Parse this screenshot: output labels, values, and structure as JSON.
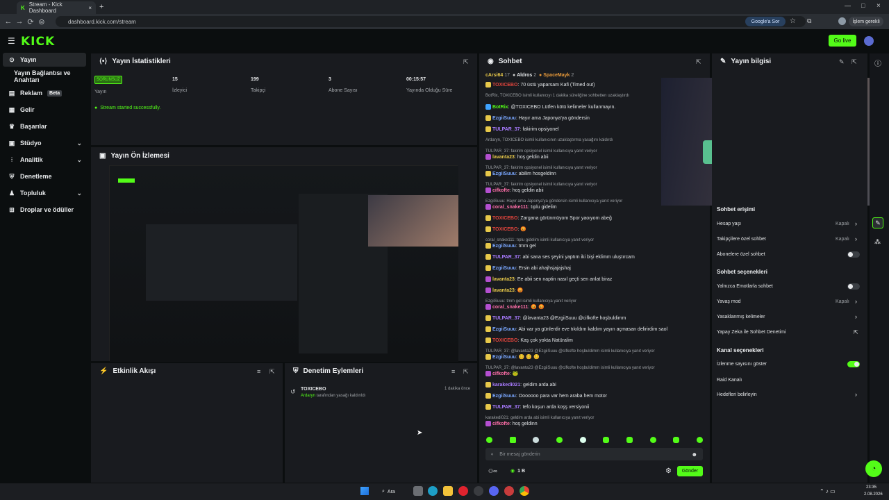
{
  "browser": {
    "tab_title": "Stream - Kick Dashboard",
    "url": "dashboard.kick.com/stream",
    "google_ask": "Google'a Sor",
    "pending": "İşlem gerekli"
  },
  "header": {
    "logo": "KICK",
    "go_live": "Go live"
  },
  "sidebar": {
    "items": [
      {
        "label": "Yayın",
        "icon": "broadcast-icon"
      },
      {
        "label": "Yayın Bağlantısı ve Anahtarı",
        "icon": ""
      },
      {
        "label": "Reklam",
        "icon": "ads-icon",
        "badge": "Beta"
      },
      {
        "label": "Gelir",
        "icon": "revenue-icon"
      },
      {
        "label": "Başarılar",
        "icon": "trophy-icon"
      },
      {
        "label": "Stüdyo",
        "icon": "studio-icon"
      },
      {
        "label": "Analitik",
        "icon": "analytics-icon"
      },
      {
        "label": "Denetleme",
        "icon": "moderation-icon"
      },
      {
        "label": "Topluluk",
        "icon": "community-icon"
      },
      {
        "label": "Droplar ve ödüller",
        "icon": "drops-icon"
      }
    ]
  },
  "stats": {
    "title": "Yayın İstatistikleri",
    "status_badge": "SORUNSUZ",
    "items": [
      {
        "label": "Yayın",
        "value": ""
      },
      {
        "label": "İzleyici",
        "value": "15"
      },
      {
        "label": "Takipçi",
        "value": "199"
      },
      {
        "label": "Abone Sayısı",
        "value": "3"
      },
      {
        "label": "Yayında Olduğu Süre",
        "value": "00:15:57"
      }
    ],
    "success_msg": "Stream started successfully."
  },
  "preview": {
    "title": "Yayın Ön İzlemesi"
  },
  "activity": {
    "title": "Etkinlik Akışı"
  },
  "mod_actions": {
    "title": "Denetim Eylemleri",
    "entry_user": "TOXICEBO",
    "entry_actor": "Ardaryn",
    "entry_text": "tarafından yasağı kaldırıldı",
    "entry_time": "1 dakika önce"
  },
  "chat": {
    "title": "Sohbet",
    "top_users": [
      {
        "name": "cArsi64",
        "count": "17"
      },
      {
        "name": "Aldros",
        "count": "2"
      },
      {
        "name": "SpaceMayk",
        "count": "2"
      }
    ],
    "lines": [
      {
        "type": "msg",
        "user": "TOXICEBO",
        "color": "red",
        "text": "70 üstü yaparsam Kafi (Timed out)"
      },
      {
        "type": "sys",
        "text": "BotRix, TOXICEBO isimli kullanıcıyı 1 dakika süreliğine sohbetten uzaklaştırdı"
      },
      {
        "type": "msg",
        "user": "BotRix",
        "color": "green",
        "text": "@TOXICEBO Lütfen kötü kelimeler kullanmayın."
      },
      {
        "type": "msg",
        "user": "EzgiiSuuu",
        "color": "blue",
        "text": "Hayır ama Japonya'ya göndersin"
      },
      {
        "type": "msg",
        "user": "TULPAR_37",
        "color": "purple",
        "text": "fakirim opsiyonel"
      },
      {
        "type": "sys",
        "text": "Ardaryn, TOXICEBO isimli kullanıcının uzaklaştırma yasağını kaldırdı"
      },
      {
        "type": "reply",
        "text": "TULPAR_37: fakirim opsiyonel isimli kullanıcıya yanıt veriyor"
      },
      {
        "type": "msg",
        "user": "lavanta23",
        "color": "gold",
        "text": "hoş geldin abii"
      },
      {
        "type": "reply",
        "text": "TULPAR_37: fakirim opsiyonel isimli kullanıcıya yanıt veriyor"
      },
      {
        "type": "msg",
        "user": "EzgiiSuuu",
        "color": "blue",
        "text": "abilim hosgeldinn"
      },
      {
        "type": "reply",
        "text": "TULPAR_37: fakirim opsiyonel isimli kullanıcıya yanıt veriyor"
      },
      {
        "type": "msg",
        "user": "cifkofte",
        "color": "pink",
        "text": "hoş geldin abii"
      },
      {
        "type": "reply",
        "text": "EzgiiSuuu: Hayır ama Japonya'ya göndersin isimli kullanıcıya yanıt veriyor"
      },
      {
        "type": "msg",
        "user": "coral_snake111",
        "color": "pink",
        "text": "tıplu gidelim"
      },
      {
        "type": "msg",
        "user": "TOXICEBO",
        "color": "red",
        "text": "Zargana görünmüyom Spor yaoıyom abeğ"
      },
      {
        "type": "msg",
        "user": "TOXICEBO",
        "color": "red",
        "text": "😡"
      },
      {
        "type": "reply",
        "text": "coral_snake111: tıplu gidelim isimli kullanıcıya yanıt veriyor"
      },
      {
        "type": "msg",
        "user": "EzgiiSuuu",
        "color": "blue",
        "text": "tmm gel"
      },
      {
        "type": "msg",
        "user": "TULPAR_37",
        "color": "purple",
        "text": "abi sana ses şeyini yaptım iki bişi eklimm uluştırcam"
      },
      {
        "type": "msg",
        "user": "EzgiiSuuu",
        "color": "blue",
        "text": "Ersin abi ahajhsjajajshaj"
      },
      {
        "type": "msg",
        "user": "lavanta23",
        "color": "gold",
        "text": "Ee abii sen naptin nasıl geçti sen anlat biraz"
      },
      {
        "type": "msg",
        "user": "lavanta23",
        "color": "gold",
        "text": "😡"
      },
      {
        "type": "reply",
        "text": "EzgiiSuuu: tmm gel isimli kullanıcıya yanıt veriyor"
      },
      {
        "type": "msg",
        "user": "coral_snake111",
        "color": "pink",
        "text": "😡 😡"
      },
      {
        "type": "msg",
        "user": "TULPAR_37",
        "color": "purple",
        "text": "@lavanta23 @EzgiiSuuu @cifkofte hoşbuldimm"
      },
      {
        "type": "msg",
        "user": "EzgiiSuuu",
        "color": "blue",
        "text": "Abi var ya günlerdir eve tıkıldım kaldım yayın açmasan delirirdim saol"
      },
      {
        "type": "msg",
        "user": "TOXICEBO",
        "color": "red",
        "text": "Kaş çok yokta Natüralim"
      },
      {
        "type": "reply",
        "text": "TULPAR_37: @lavanta23 @EzgiiSuuu @cifkofte hoşbuldimm isimli kullanıcıya yanıt veriyor"
      },
      {
        "type": "msg",
        "user": "EzgiiSuuu",
        "color": "blue",
        "text": "😊 😊 😊"
      },
      {
        "type": "reply",
        "text": "TULPAR_37: @lavanta23 @EzgiiSuuu @cifkofte hoşbuldimm isimli kullanıcıya yanıt veriyor"
      },
      {
        "type": "msg",
        "user": "cifkofte",
        "color": "pink",
        "text": "🐸"
      },
      {
        "type": "msg",
        "user": "karakedi021",
        "color": "purple",
        "text": "geldim arda abi"
      },
      {
        "type": "msg",
        "user": "EzgiiSuuu",
        "color": "blue",
        "text": "Ooooooo para var hem araba hem motor"
      },
      {
        "type": "msg",
        "user": "TULPAR_37",
        "color": "purple",
        "text": "tefo koşun arda koşş versiyonii"
      },
      {
        "type": "reply",
        "text": "karakedi021: geldim arda abi isimli kullanıcıya yanıt veriyor"
      },
      {
        "type": "msg",
        "user": "cifkofte",
        "color": "pink",
        "text": "hoş geldinn"
      }
    ],
    "input_placeholder": "Bir mesaj gönderin",
    "viewer_count": "1 B",
    "send_label": "Gönder"
  },
  "stream_info": {
    "title": "Yayın bilgisi",
    "chat_access_title": "Sohbet erişimi",
    "chat_options_title": "Sohbet seçenekleri",
    "channel_options_title": "Kanal seçenekleri",
    "rows_access": [
      {
        "label": "Hesap yaşı",
        "value": "Kapalı"
      },
      {
        "label": "Takipçilere özel sohbet",
        "value": "Kapalı"
      },
      {
        "label": "Abonelere özel sohbet",
        "value": ""
      }
    ],
    "rows_options": [
      {
        "label": "Yalnızca Emotlarla sohbet",
        "value": ""
      },
      {
        "label": "Yavaş mod",
        "value": "Kapalı"
      },
      {
        "label": "Yasaklanmış kelimeler",
        "value": ""
      },
      {
        "label": "Yapay Zeka ile Sohbet Denetimi",
        "value": ""
      }
    ],
    "rows_channel": [
      {
        "label": "İzlenme sayısını göster",
        "value": ""
      },
      {
        "label": "Raid Kanalı",
        "value": ""
      },
      {
        "label": "Hedefleri belirleyin",
        "value": ""
      }
    ]
  },
  "taskbar": {
    "search": "Ara",
    "time": "23:35",
    "date": "2.08.2026"
  },
  "colors": {
    "accent": "#53fc18",
    "bg": "#0b0e0f",
    "panel": "#191b1f"
  }
}
